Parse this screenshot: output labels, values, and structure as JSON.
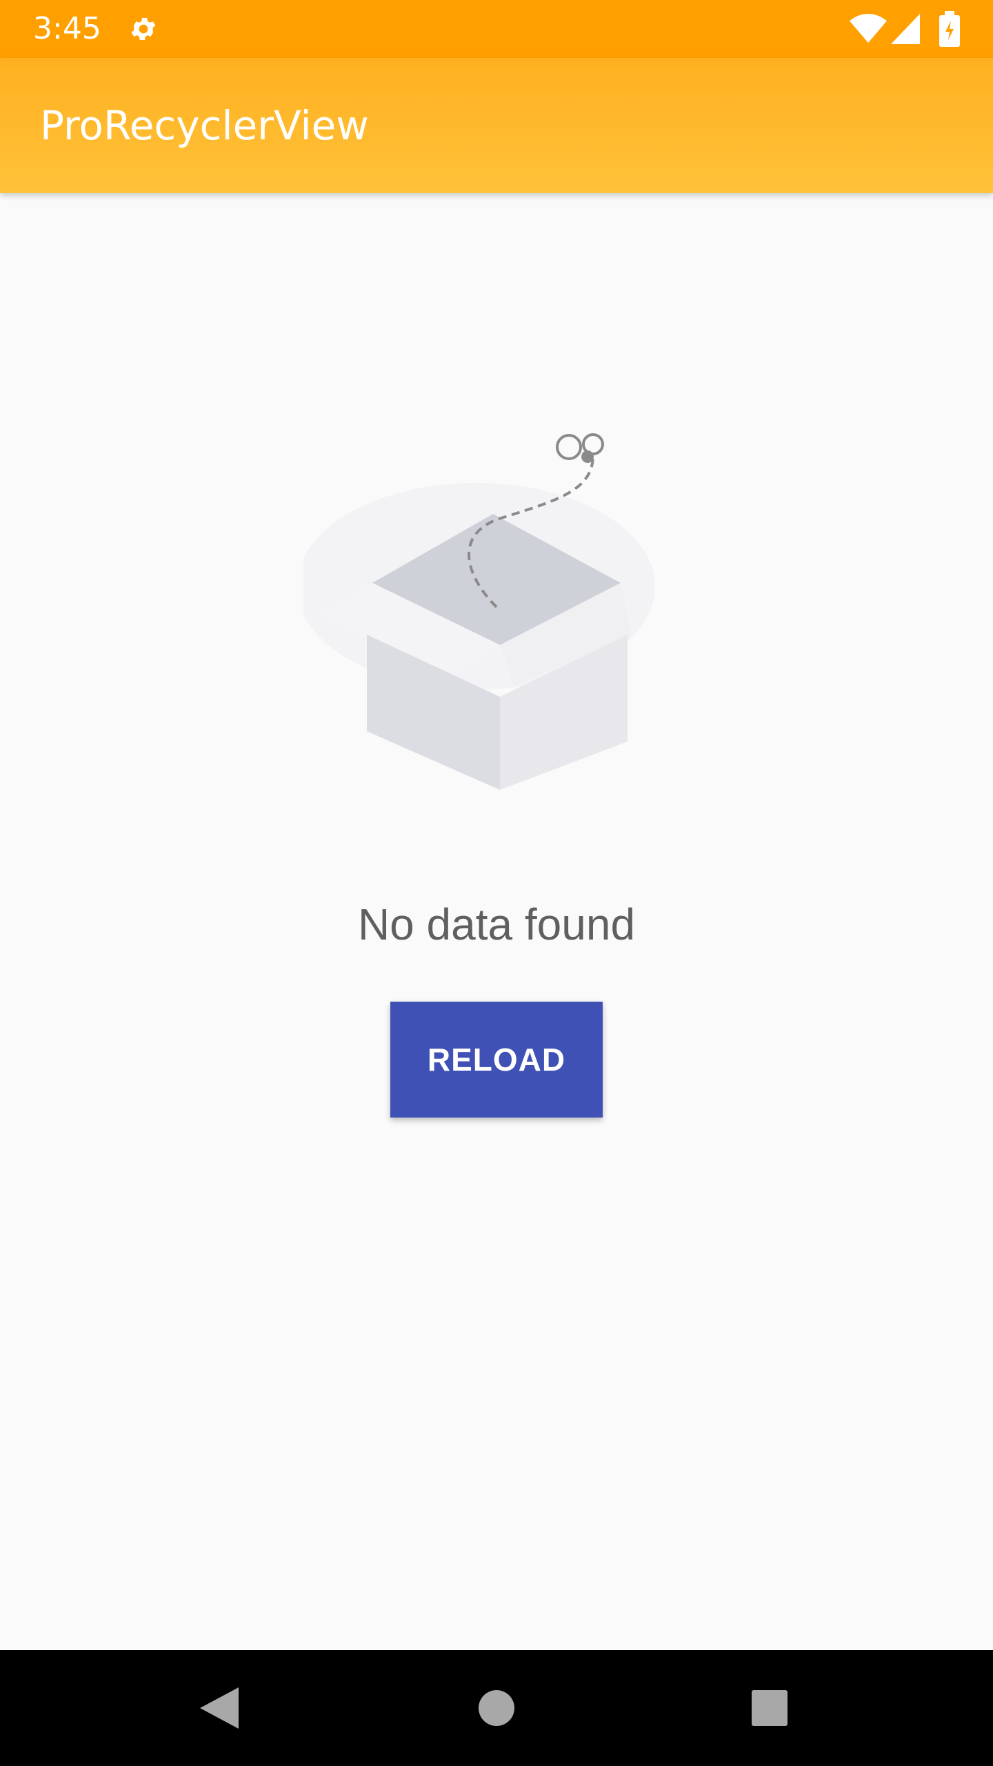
{
  "status_bar": {
    "time": "3:45",
    "background": "#ff9f00",
    "icons": [
      "gear-icon",
      "wifi-icon",
      "signal-icon",
      "battery-icon"
    ]
  },
  "toolbar": {
    "title": "ProRecyclerView",
    "background": "#ffb020"
  },
  "empty_state": {
    "illustration": "open-box-icon",
    "message": "No data found",
    "reload_label": "RELOAD",
    "button_color": "#3f51b5"
  },
  "nav_bar": {
    "buttons": [
      "back-icon",
      "home-icon",
      "recents-icon"
    ]
  }
}
